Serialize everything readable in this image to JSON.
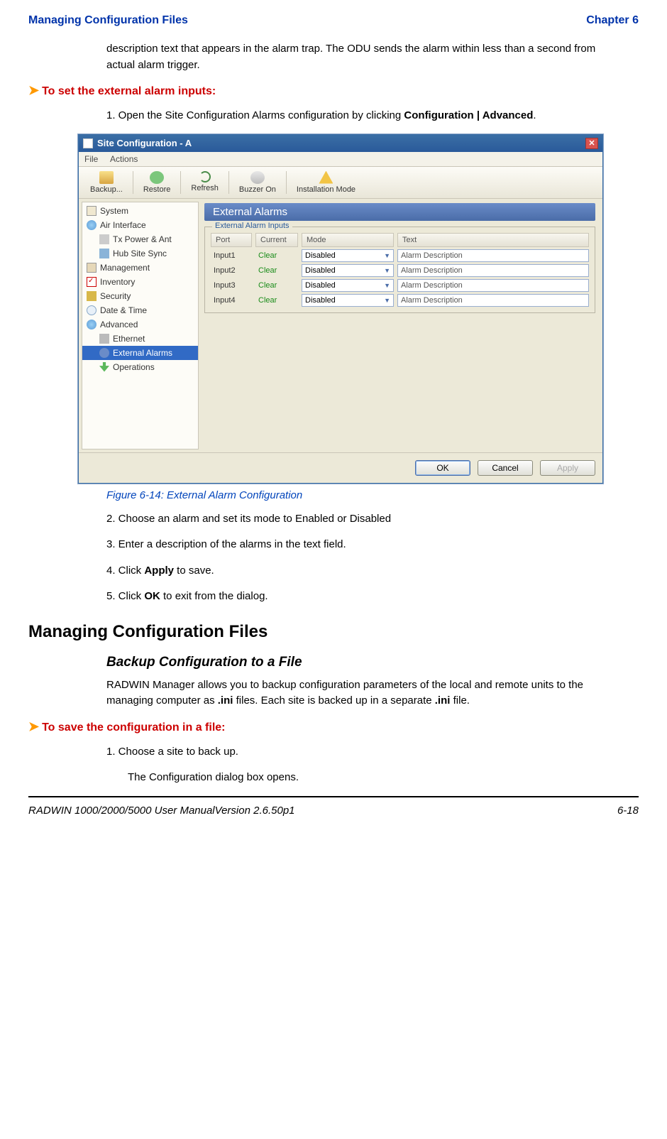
{
  "header": {
    "left": "Managing Configuration Files",
    "right": "Chapter 6"
  },
  "intro": "description text that appears in the alarm trap. The ODU sends the alarm within less than a second from actual alarm trigger.",
  "proc1": {
    "title": "To set the external alarm inputs:",
    "step1_a": "1. Open the Site Configuration Alarms configuration by clicking ",
    "step1_b": "Configuration | Advanced",
    "step1_c": "."
  },
  "win": {
    "title": "Site Configuration - A",
    "menus": [
      "File",
      "Actions"
    ],
    "toolbar": [
      "Backup...",
      "Restore",
      "Refresh",
      "Buzzer On",
      "Installation Mode"
    ],
    "sidebar": [
      {
        "label": "System",
        "ico": "ico-sys"
      },
      {
        "label": "Air Interface",
        "ico": "ico-air"
      },
      {
        "label": "Tx Power & Ant",
        "ico": "ico-tx",
        "indent": true
      },
      {
        "label": "Hub Site Sync",
        "ico": "ico-hub",
        "indent": true
      },
      {
        "label": "Management",
        "ico": "ico-mgmt"
      },
      {
        "label": "Inventory",
        "ico": "ico-inv"
      },
      {
        "label": "Security",
        "ico": "ico-sec"
      },
      {
        "label": "Date & Time",
        "ico": "ico-dt"
      },
      {
        "label": "Advanced",
        "ico": "ico-adv"
      },
      {
        "label": "Ethernet",
        "ico": "ico-eth",
        "indent": true
      },
      {
        "label": "External Alarms",
        "ico": "ico-ext",
        "indent": true,
        "sel": true
      },
      {
        "label": "Operations",
        "ico": "ico-ops",
        "indent": true
      }
    ],
    "panel_title": "External Alarms",
    "group_legend": "External Alarm Inputs",
    "headers": [
      "Port",
      "Current",
      "Mode",
      "Text"
    ],
    "rows": [
      {
        "port": "Input1",
        "cur": "Clear",
        "mode": "Disabled",
        "text": "Alarm Description"
      },
      {
        "port": "Input2",
        "cur": "Clear",
        "mode": "Disabled",
        "text": "Alarm Description"
      },
      {
        "port": "Input3",
        "cur": "Clear",
        "mode": "Disabled",
        "text": "Alarm Description"
      },
      {
        "port": "Input4",
        "cur": "Clear",
        "mode": "Disabled",
        "text": "Alarm Description"
      }
    ],
    "buttons": {
      "ok": "OK",
      "cancel": "Cancel",
      "apply": "Apply"
    }
  },
  "figcap": "Figure 6-14: External Alarm Configuration",
  "steps_after": [
    "2. Choose an alarm and set its mode to Enabled or Disabled",
    "3. Enter a description of the alarms in the text field."
  ],
  "step4": {
    "a": "4. Click ",
    "b": "Apply",
    "c": " to save."
  },
  "step5": {
    "a": "5. Click ",
    "b": "OK",
    "c": " to exit from the dialog."
  },
  "h2": "Managing Configuration Files",
  "h3": "Backup Configuration to a File",
  "para": {
    "a": "RADWIN Manager allows you to backup configuration parameters of the local and remote units to the managing computer as ",
    "b": ".ini",
    "c": " files. Each site is backed up in a separate ",
    "d": ".ini",
    "e": " file."
  },
  "proc2": {
    "title": "To save the configuration in a file:",
    "s1": "1. Choose a site to back up.",
    "s1b": "The Configuration dialog box opens."
  },
  "footer": {
    "left": "RADWIN 1000/2000/5000 User ManualVersion  2.6.50p1",
    "right": "6-18"
  }
}
